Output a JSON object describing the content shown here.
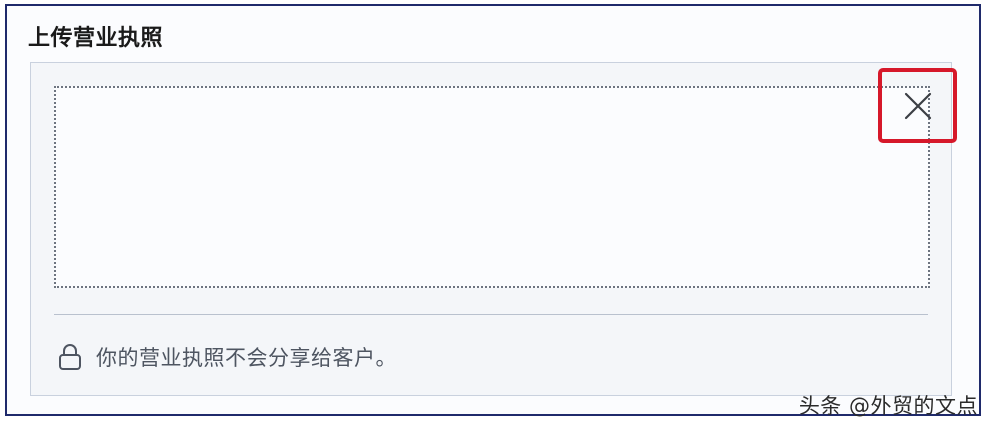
{
  "section": {
    "title": "上传营业执照"
  },
  "upload": {
    "close_icon": "close-icon",
    "privacy_icon": "lock-icon",
    "privacy_text": "你的营业执照不会分享给客户。"
  },
  "watermark": {
    "text": "头条 @外贸的文点"
  },
  "colors": {
    "frame_border": "#1f2a6b",
    "highlight_red": "#d6182a",
    "panel_bg": "#f4f6f9",
    "dotted_border": "#6d7480"
  }
}
